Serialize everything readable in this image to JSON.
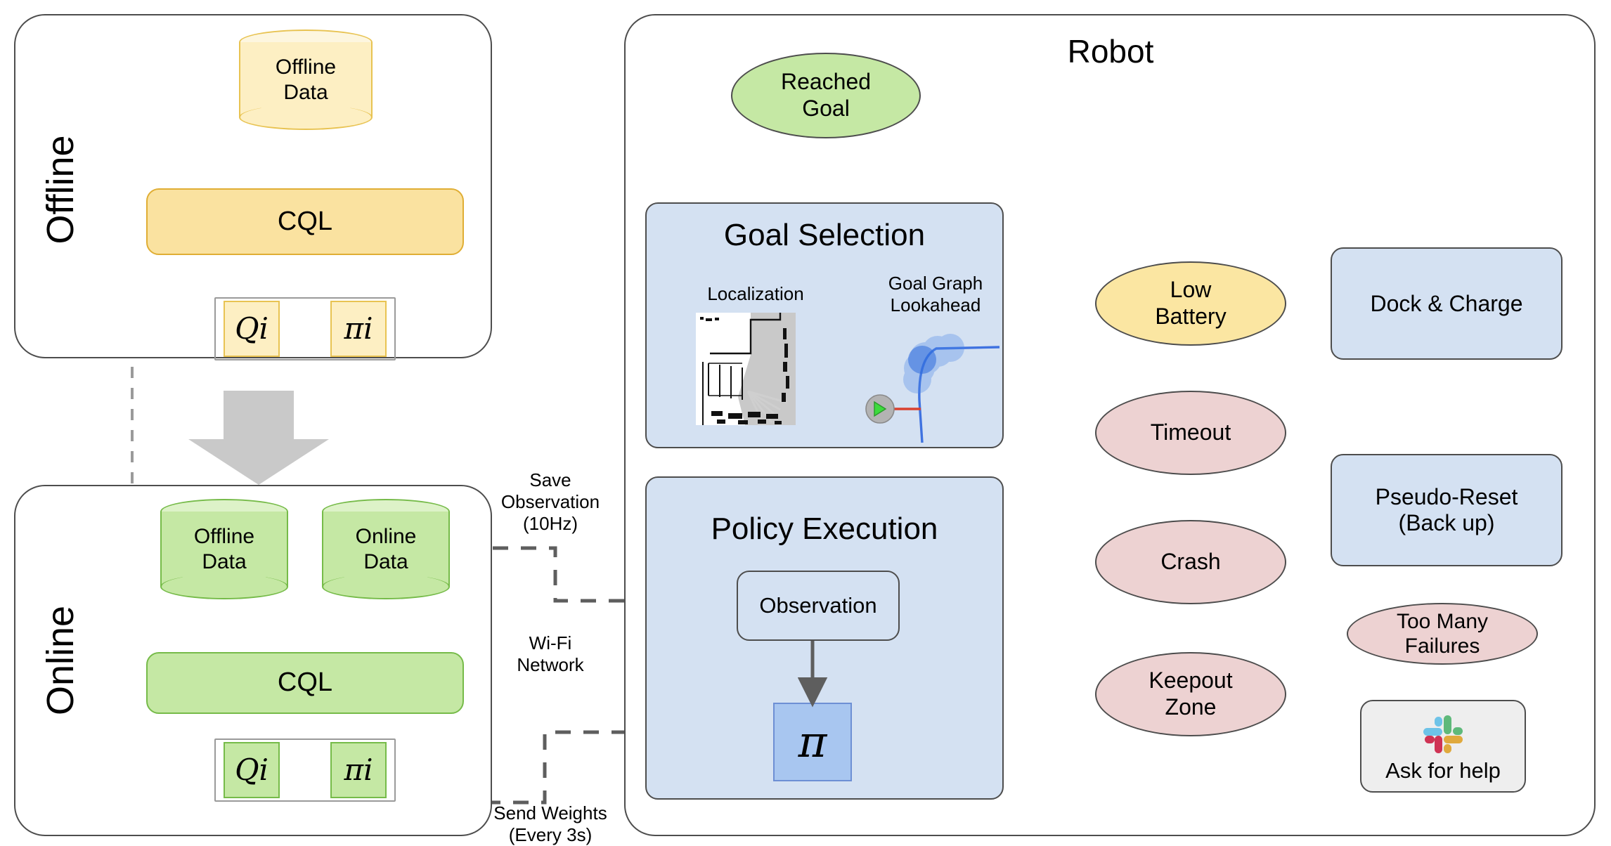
{
  "offline": {
    "section_label": "Offline",
    "data_store": "Offline\nData",
    "algorithm": "CQL",
    "outputs": [
      {
        "symbol": "Q",
        "subscript": "i"
      },
      {
        "symbol": "π",
        "subscript": "i"
      }
    ]
  },
  "online": {
    "section_label": "Online",
    "data_stores": [
      "Offline\nData",
      "Online\nData"
    ],
    "algorithm": "CQL",
    "outputs": [
      {
        "symbol": "Q",
        "subscript": "i"
      },
      {
        "symbol": "π",
        "subscript": "i"
      }
    ]
  },
  "network": {
    "save_observation": "Save\nObservation\n(10Hz)",
    "name": "Wi-Fi\nNetwork",
    "send_weights": "Send Weights\n(Every 3s)"
  },
  "robot": {
    "title": "Robot",
    "reached_goal": "Reached\nGoal",
    "goal_selection": {
      "title": "Goal Selection",
      "localization_caption": "Localization",
      "lookahead_caption": "Goal Graph\nLookahead"
    },
    "policy_execution": {
      "title": "Policy Execution",
      "observation": "Observation",
      "policy_symbol": "π"
    },
    "events": [
      {
        "label": "Low\nBattery",
        "kind": "battery"
      },
      {
        "label": "Timeout",
        "kind": "failure"
      },
      {
        "label": "Crash",
        "kind": "failure"
      },
      {
        "label": "Keepout\nZone",
        "kind": "failure"
      }
    ],
    "recoveries": [
      {
        "label": "Dock & Charge"
      },
      {
        "label": "Pseudo-Reset\n(Back up)"
      }
    ],
    "too_many_failures": "Too Many\nFailures",
    "ask_for_help": {
      "label": "Ask for help",
      "icon": "slack-icon"
    }
  },
  "colors": {
    "offline_accent": "#e8c352",
    "online_accent": "#76bb49",
    "robot_panel": "#d4e1f2",
    "failure": "#edd2d2",
    "battery": "#fbe6a2",
    "line": "#4d4d4d"
  }
}
